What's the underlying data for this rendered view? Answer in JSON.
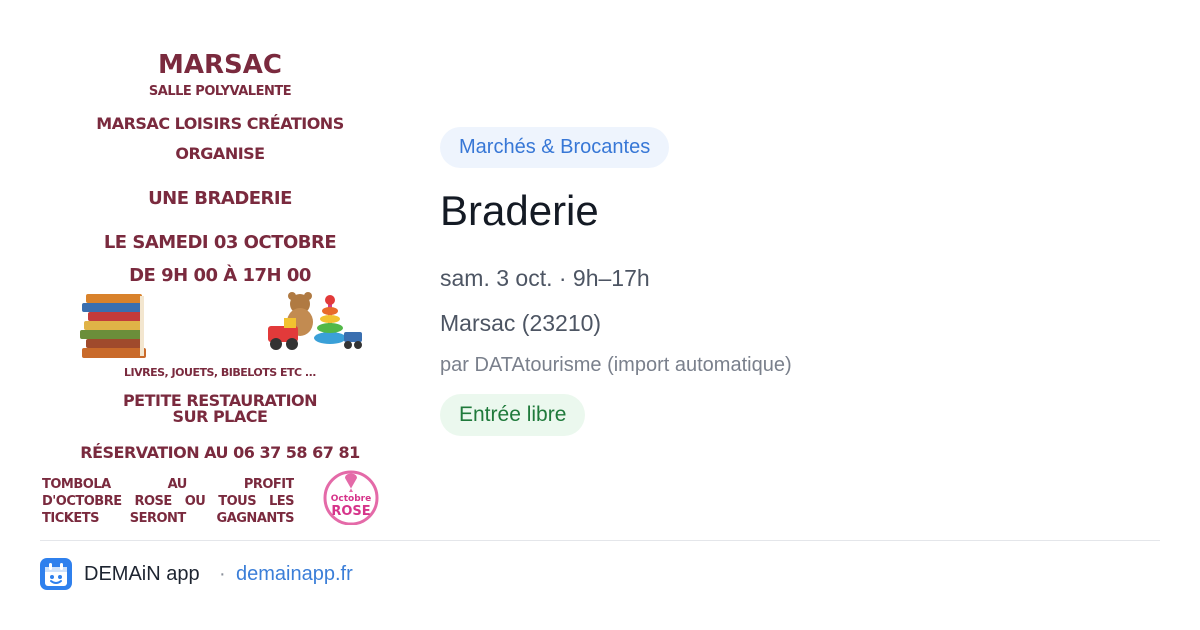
{
  "poster": {
    "title": "MARSAC",
    "venue": "SALLE POLYVALENTE",
    "organizer_line1": "MARSAC LOISIRS CRÉATIONS",
    "organizer_line2": "ORGANISE",
    "event": "UNE BRADERIE",
    "date": "LE SAMEDI 03 OCTOBRE",
    "hours": "DE 9H 00 À 17H 00",
    "items": "LIVRES, JOUETS, BIBELOTS ETC ...",
    "food_line1": "PETITE RESTAURATION",
    "food_line2": "SUR PLACE",
    "reservation": "RÉSERVATION AU 06 37 58 67 81",
    "tombola_line1": "TOMBOLA AU PROFIT",
    "tombola_line2": "D'OCTOBRE ROSE OU TOUS LES",
    "tombola_line3": "TICKETS SERONT GAGNANTS",
    "badge_line1": "Octobre",
    "badge_line2": "ROSE"
  },
  "event": {
    "category": "Marchés & Brocantes",
    "title": "Braderie",
    "datetime": "sam. 3 oct. · 9h–17h",
    "location": "Marsac (23210)",
    "source": "par DATAtourisme (import automatique)",
    "price": "Entrée libre"
  },
  "footer": {
    "app_name": "DEMAiN app",
    "separator": "·",
    "link": "demainapp.fr"
  },
  "colors": {
    "poster_text": "#7a2a3e",
    "tag_bg": "#eef4fd",
    "tag_text": "#3777d6",
    "price_bg": "#ebf8ee",
    "price_text": "#1f7a3b",
    "link": "#3b7ed8",
    "app_icon": "#2f80ed"
  },
  "icons": {
    "app": "demain-app-icon",
    "books": "books-illustration",
    "toys": "toys-illustration",
    "badge": "pink-ribbon-badge"
  }
}
